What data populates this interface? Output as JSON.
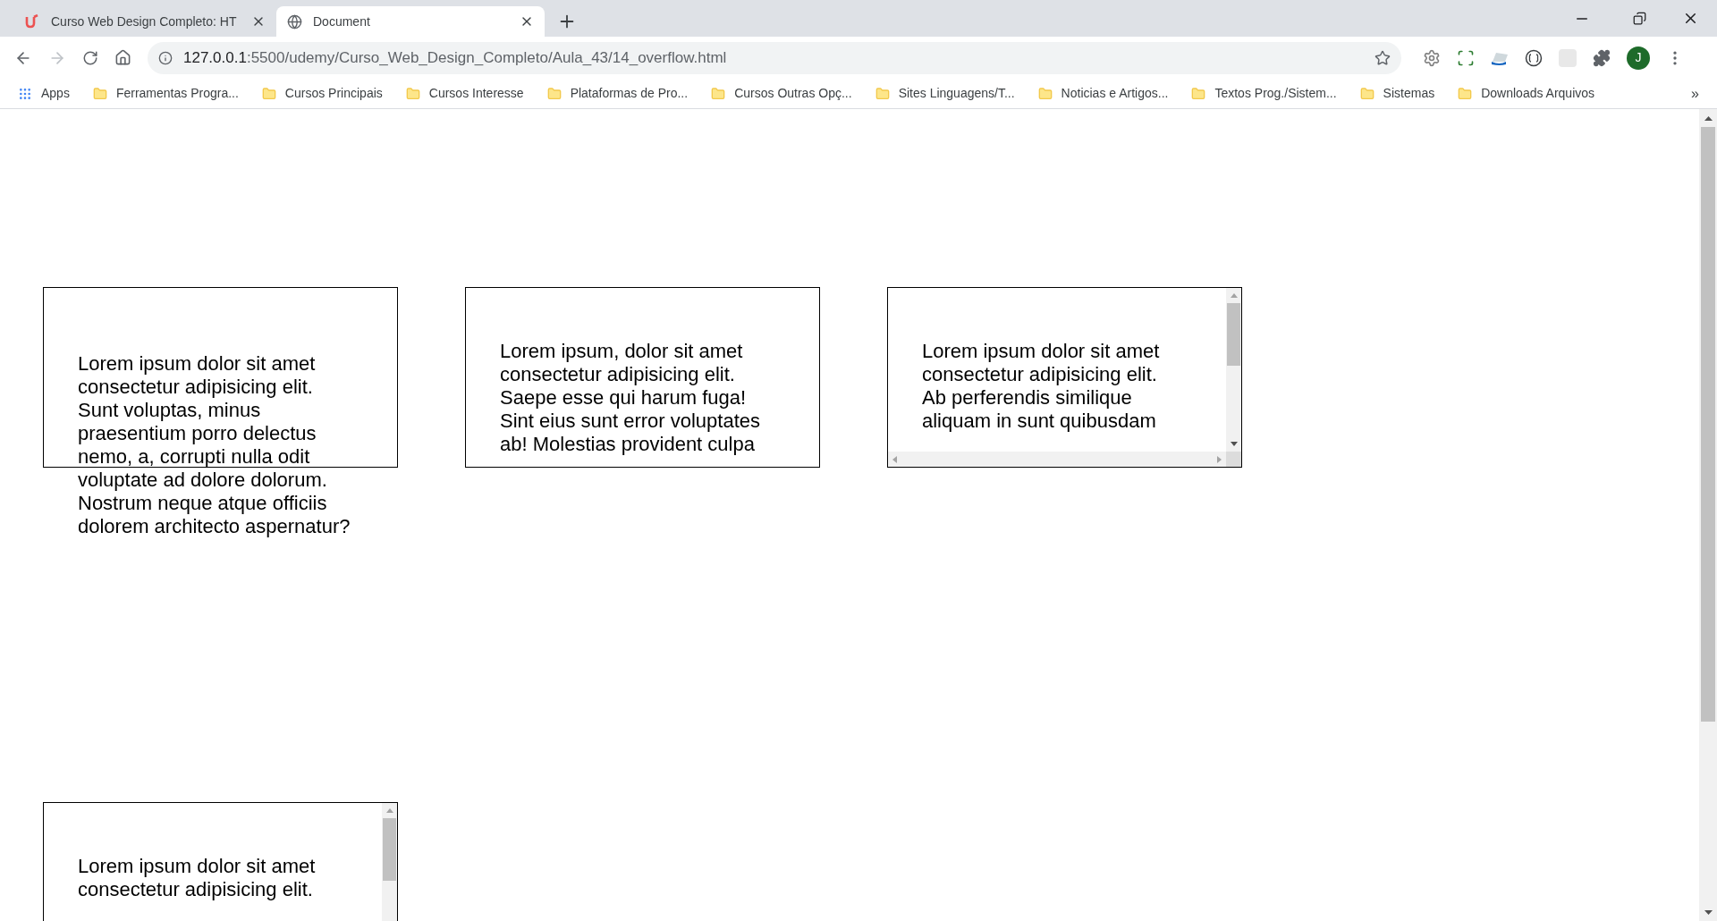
{
  "tabs": [
    {
      "kind": "udemy",
      "title": "Curso Web Design Completo: HT",
      "selected": false
    },
    {
      "kind": "globe",
      "title": "Document",
      "selected": true
    }
  ],
  "address_bar": {
    "host": "127.0.0.1",
    "path": ":5500/udemy/Curso_Web_Design_Completo/Aula_43/14_overflow.html"
  },
  "profile": {
    "initial": "J"
  },
  "bookmarks_bar": {
    "apps": "Apps",
    "items": [
      "Ferramentas Progra...",
      "Cursos Principais",
      "Cursos Interesse",
      "Plataformas de Pro...",
      "Cursos Outras Opç...",
      "Sites Linguagens/T...",
      "Noticias e Artigos...",
      "Textos Prog./Sistem...",
      "Sistemas",
      "Downloads Arquivos"
    ],
    "more": "»"
  },
  "boxes": [
    {
      "kind": "visible",
      "text": "Lorem ipsum dolor sit amet consectetur adipisicing elit. Sunt voluptas, minus praesentium porro delectus nemo, a, corrupti nulla odit voluptate ad dolore dolorum. Nostrum neque atque officiis dolorem architecto aspernatur?"
    },
    {
      "kind": "hidden",
      "text": "Lorem ipsum, dolor sit amet consectetur adipisicing elit. Saepe esse qui harum fuga! Sint eius sunt error voluptates ab! Molestias provident culpa"
    },
    {
      "kind": "scroll",
      "text": "Lorem ipsum dolor sit amet consectetur adipisicing elit. Ab perferendis similique aliquam in sunt quibusdam"
    },
    {
      "kind": "auto",
      "text": "Lorem ipsum dolor sit amet consectetur adipisicing elit."
    }
  ]
}
